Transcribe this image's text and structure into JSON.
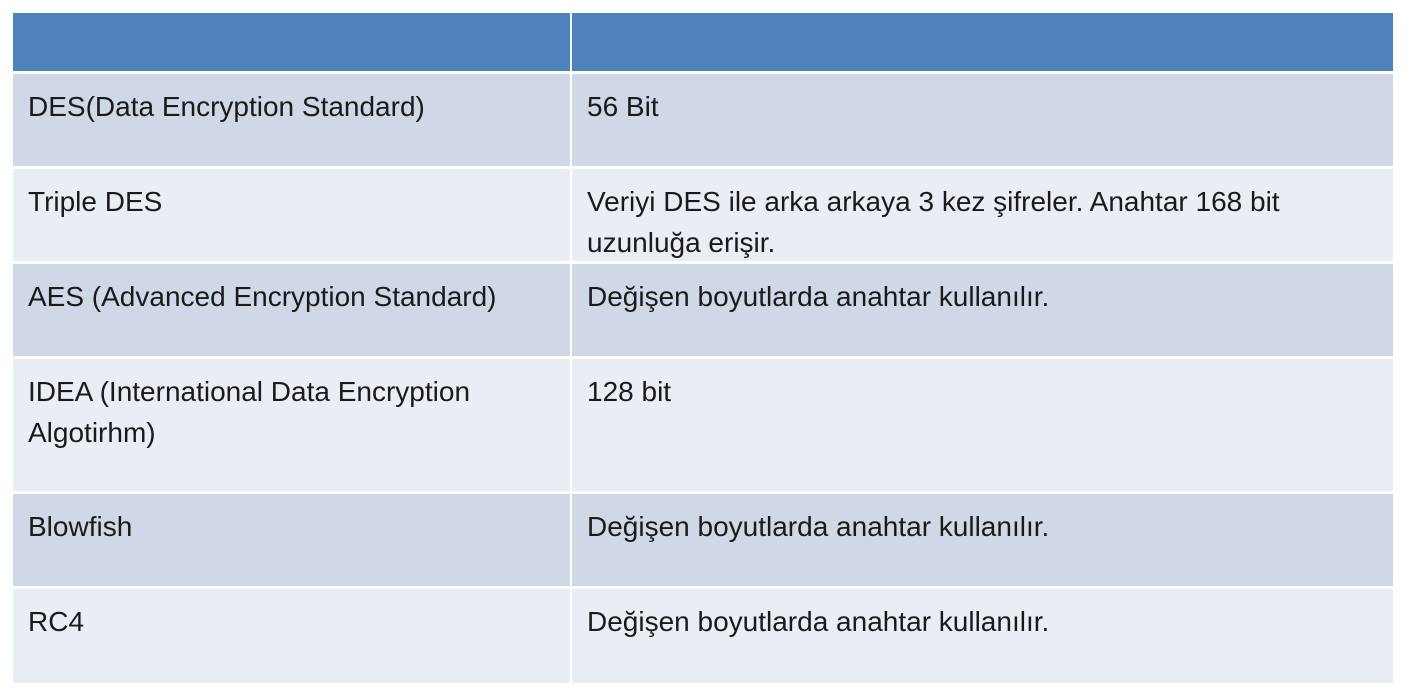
{
  "table": {
    "colors": {
      "header_bg": "#4f81bd",
      "row_odd_bg": "#d0d8e8",
      "row_even_bg": "#e9edf4"
    },
    "header": [
      "",
      ""
    ],
    "rows": [
      {
        "algorithm": "DES(Data Encryption Standard)",
        "description": "56 Bit"
      },
      {
        "algorithm": "Triple DES",
        "description": "Veriyi DES ile arka arkaya 3 kez şifreler. Anahtar 168 bit uzunluğa erişir."
      },
      {
        "algorithm": "AES (Advanced Encryption Standard)",
        "description": "Değişen boyutlarda anahtar kullanılır."
      },
      {
        "algorithm": "IDEA (International Data Encryption Algotirhm)",
        "description": "128 bit"
      },
      {
        "algorithm": "Blowfish",
        "description": "Değişen boyutlarda anahtar kullanılır."
      },
      {
        "algorithm": "RC4",
        "description": "Değişen boyutlarda anahtar kullanılır."
      }
    ]
  }
}
